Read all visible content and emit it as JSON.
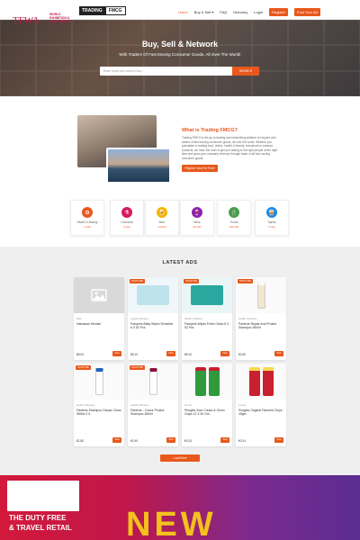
{
  "header": {
    "logo": [
      "TRADING",
      "FMCG"
    ],
    "nav": [
      "Home",
      "Buy & Sell ▾",
      "FAQ",
      "Directory",
      "Login",
      "Register",
      "Post Your Ad"
    ]
  },
  "hero": {
    "title": "Buy, Sell & Network",
    "subtitle": "With Traders Of Fast Moving Consumer Goods, All Over The World!",
    "search_placeholder": "Enter what you want to buy...",
    "search_button": "SEARCH"
  },
  "about": {
    "title": "What is Trading FMCG?",
    "text": "Trading FMCG is the go-to trading and networking platform for buyers and sellers of fast moving consumer goods, all over the world. Whether you specialise in trading food, drinks, health & beauty, household or tobacco products, we have the tools to get you talking to the right people at the right time and grow your company revenue through trade of all fast moving consumer goods.",
    "button": "Register Now For Free!"
  },
  "categories": [
    {
      "name": "Health & Beauty",
      "count": "2 Ads",
      "color": "#e8581c",
      "icon": "✿"
    },
    {
      "name": "Chemical",
      "count": "6 Ads",
      "color": "#d81b60",
      "icon": "⚗"
    },
    {
      "name": "Beer",
      "count": "14 Ads",
      "color": "#f5b400",
      "icon": "🍺"
    },
    {
      "name": "Wine",
      "count": "22 Ads",
      "color": "#8e24aa",
      "icon": "🍷"
    },
    {
      "name": "Foods",
      "count": "120 Ads",
      "color": "#43a047",
      "icon": "🍴"
    },
    {
      "name": "Spirits",
      "count": "5 Ads",
      "color": "#1e88e5",
      "icon": "🥃"
    }
  ],
  "latest_ads": {
    "title": "LATEST ADS",
    "badge": "TRUST ME",
    "view_label": "View",
    "load_more": "Load More",
    "ads": [
      {
        "category": "Bath",
        "title": "Halvaisan Wonkel",
        "price": "$8.00",
        "badge": false,
        "colors": [
          "#d9d9d9",
          "#bdbdbd"
        ]
      },
      {
        "category": "Health & Beauty",
        "title": "Pampers Baby Wipes Sensitive 6 X 52 Pcs",
        "price": "€8.10",
        "badge": true,
        "colors": [
          "#bfe3ea",
          "#f0f7fa"
        ]
      },
      {
        "category": "Health & Beauty",
        "title": "Pampers Wipes Fresh Clean 6 X 52 Pcs",
        "price": "€8.10",
        "badge": true,
        "colors": [
          "#2aa8a0",
          "#e9f6f5"
        ]
      },
      {
        "category": "Health & Beauty",
        "title": "Pantene Repair And Protect Shampoo 360ml",
        "price": "€2.80",
        "badge": true,
        "colors": [
          "#f2e7d0",
          "#fafafa"
        ]
      },
      {
        "category": "Health & Beauty",
        "title": "Pantene Shampoo Classic Clean 360ml X 6",
        "price": "€1.80",
        "badge": true,
        "colors": [
          "#ffffff",
          "#1e63b7"
        ]
      },
      {
        "category": "Health & Beauty",
        "title": "Pantene - Colour Protect Shampoo 360ml",
        "price": "€1.90",
        "badge": true,
        "colors": [
          "#ffffff",
          "#8a1038"
        ]
      },
      {
        "category": "Foods",
        "title": "Pringles Sour Cream & Onion Chips 12 X 40 Grs",
        "price": "€0.24",
        "badge": false,
        "colors": [
          "#2e9a3c",
          "#c8202f"
        ]
      },
      {
        "category": "Foods",
        "title": "Pringles Original Flavored Chips 40gm",
        "price": "€0.24",
        "badge": false,
        "colors": [
          "#c8202f",
          "#f6d94f"
        ]
      }
    ]
  },
  "banner": {
    "logo": "TFWA",
    "logo_side": "WORLD EXHIBITION & CONFERENCE",
    "tagline": [
      "THE DUTY FREE",
      "& TRAVEL RETAIL"
    ],
    "word": "NEW"
  }
}
